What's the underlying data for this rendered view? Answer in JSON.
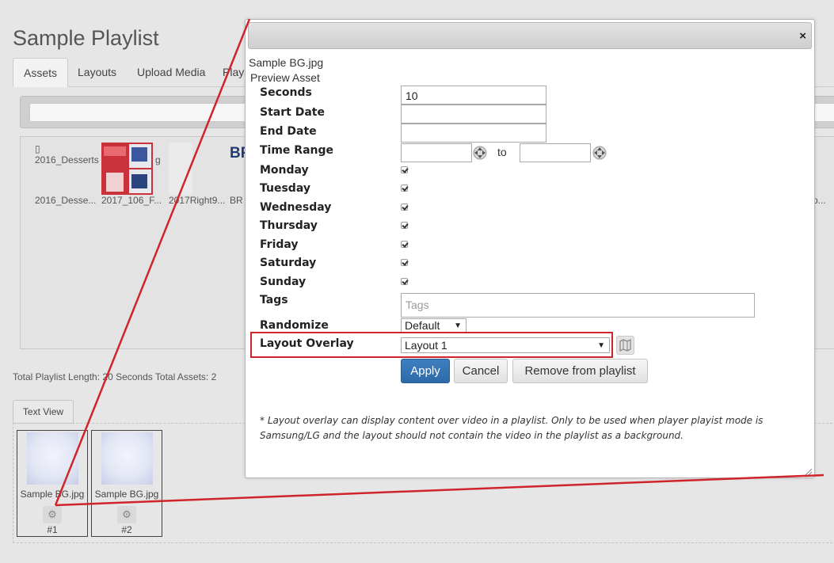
{
  "page": {
    "title": "Sample Playlist"
  },
  "tabs": [
    {
      "label": "Assets"
    },
    {
      "label": "Layouts"
    },
    {
      "label": "Upload Media"
    },
    {
      "label": "Playl"
    }
  ],
  "assets": [
    {
      "caption": "2016_Desse...",
      "broken_label": "2016_Desserts"
    },
    {
      "caption": "2017_106_F...",
      "overflow_label": "g"
    },
    {
      "caption": "2017Right9..."
    },
    {
      "caption": "BR",
      "thumb_text": "BR"
    },
    {
      "caption": "p..."
    }
  ],
  "summary": "Total Playlist Length: 20 Seconds Total Assets: 2",
  "text_view_button": "Text View",
  "playlist_items": [
    {
      "name": "Sample BG.jpg",
      "number": "#1"
    },
    {
      "name": "Sample BG.jpg",
      "number": "#2"
    }
  ],
  "dialog": {
    "close": "×",
    "filename": "Sample BG.jpg",
    "preview": "Preview Asset",
    "seconds": {
      "label": "Seconds",
      "value": "10"
    },
    "start_date": {
      "label": "Start Date",
      "value": ""
    },
    "end_date": {
      "label": "End Date",
      "value": ""
    },
    "time_range": {
      "label": "Time Range",
      "to": "to",
      "from_value": "",
      "to_value": ""
    },
    "days": [
      {
        "label": "Monday",
        "checked": true
      },
      {
        "label": "Tuesday",
        "checked": true
      },
      {
        "label": "Wednesday",
        "checked": true
      },
      {
        "label": "Thursday",
        "checked": true
      },
      {
        "label": "Friday",
        "checked": true
      },
      {
        "label": "Saturday",
        "checked": true
      },
      {
        "label": "Sunday",
        "checked": true
      }
    ],
    "tags": {
      "label": "Tags",
      "placeholder": "Tags"
    },
    "randomize": {
      "label": "Randomize",
      "value": "Default"
    },
    "layout_overlay": {
      "label": "Layout Overlay",
      "value": "Layout 1"
    },
    "buttons": {
      "apply": "Apply",
      "cancel": "Cancel",
      "remove": "Remove from playlist"
    },
    "note": "* Layout overlay can display content over video in a playlist. Only to be used when player playist mode is Samsung/LG and the layout should not contain the video in the playlist as a background."
  },
  "colors": {
    "accent": "#2e6aa8",
    "highlight": "#d0242b"
  },
  "icons": {
    "settings": "gear-icon",
    "spinner": "spin-arrows-icon",
    "map": "map-icon",
    "close": "close-icon"
  }
}
